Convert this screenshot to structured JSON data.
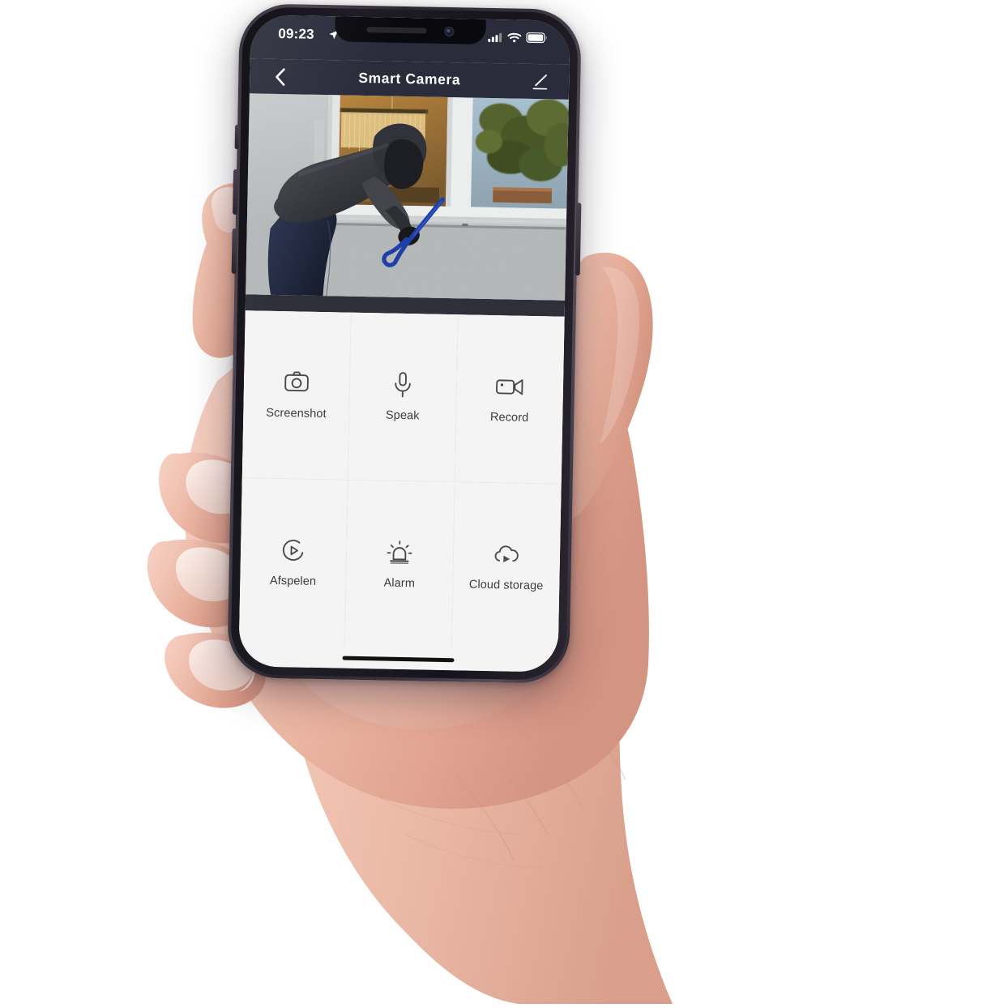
{
  "device": {
    "kind": "smartphone",
    "orientation": "portrait",
    "frame_color": "#302b36",
    "held_by": "right-hand"
  },
  "status_bar": {
    "time": "09:23",
    "location_icon": "location-arrow-icon",
    "signal_icon": "cellular-signal-icon",
    "signal_bars_filled": 3,
    "signal_bars_total": 4,
    "wifi_icon": "wifi-icon",
    "battery_icon": "battery-icon",
    "battery_level_pct": 88,
    "background": "#2b2c3b",
    "foreground": "#ffffff"
  },
  "nav_bar": {
    "back_icon": "chevron-left-icon",
    "title": "Smart  Camera",
    "edit_icon": "pencil-edit-icon",
    "background": "#2b2c3b"
  },
  "video_feed": {
    "alt": "Live camera view of a person in dark hooded clothing and balaclava prying at a house window with a blue crowbar",
    "letterbox_color": "#2e3039",
    "scene": {
      "wall_color": "#b9bcbd",
      "window_frame_color": "#e9eaea",
      "interior_glow_color": "#a4793a",
      "intruder_top_color": "#3a3b40",
      "intruder_bottom_color": "#242a3d",
      "crowbar_color": "#1f3fa8",
      "foliage_color": "#4e5b2e",
      "sky_color": "#9fb7c6"
    }
  },
  "controls": {
    "background": "#f4f4f4",
    "divider_color": "#eaeaea",
    "label_color": "#3c3c3c",
    "items": [
      {
        "label": "Screenshot",
        "icon": "camera-icon"
      },
      {
        "label": "Speak",
        "icon": "microphone-icon"
      },
      {
        "label": "Record",
        "icon": "video-camera-icon"
      },
      {
        "label": "Afspelen",
        "icon": "playback-circle-icon"
      },
      {
        "label": "Alarm",
        "icon": "siren-alarm-icon"
      },
      {
        "label": "Cloud storage",
        "icon": "cloud-play-icon"
      }
    ]
  },
  "home_indicator": {
    "name": "home-indicator-bar",
    "color": "#111111"
  }
}
